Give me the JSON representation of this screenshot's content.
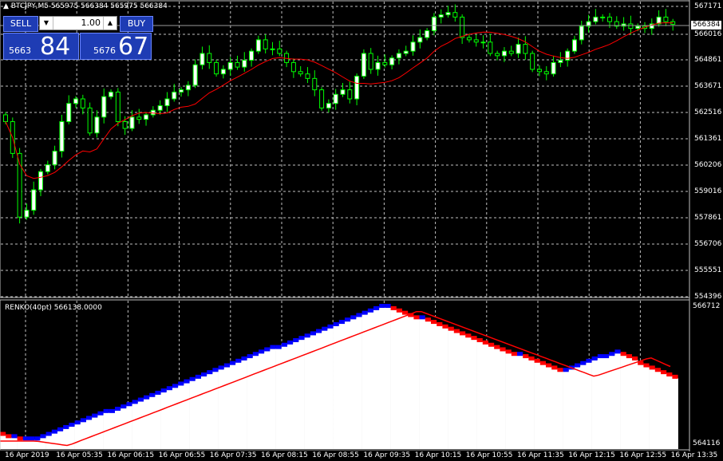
{
  "main_header": "BTCJPY,M5  565975 566384 565975 566384",
  "trade_panel": {
    "sell_label": "SELL",
    "buy_label": "BUY",
    "lot": "1.00",
    "bid_small": "5663",
    "bid_big": "84",
    "ask_small": "5676",
    "ask_big": "67"
  },
  "price_axis": [
    "567171",
    "566016",
    "564861",
    "563671",
    "562516",
    "561361",
    "560206",
    "559016",
    "557861",
    "556706",
    "555551",
    "554396"
  ],
  "current_price": "566384",
  "sub_header": "RENKO(40pt) 566138.0000",
  "sub_axis": {
    "top": "566712",
    "bottom": "564116"
  },
  "time_axis": [
    "16 Apr 2019",
    "16 Apr 05:35",
    "16 Apr 06:15",
    "16 Apr 06:55",
    "16 Apr 07:35",
    "16 Apr 08:15",
    "16 Apr 08:55",
    "16 Apr 09:35",
    "16 Apr 10:15",
    "16 Apr 10:55",
    "16 Apr 11:35",
    "16 Apr 12:15",
    "16 Apr 12:55",
    "16 Apr 13:35"
  ],
  "colors": {
    "background": "#000000",
    "grid": "#c0c0c0",
    "bull_candle": "#ffffff",
    "bear_candle": "#000000",
    "wick": "#00ff00",
    "moving_average": "#ff0000",
    "renko_up": "#0000ff",
    "renko_down": "#ff0000",
    "renko_fill": "#ffffff"
  },
  "chart_data": {
    "type": "candlestick",
    "symbol": "BTCJPY",
    "timeframe": "M5",
    "ylim": [
      554396,
      567171
    ],
    "candles_close_approx": [
      562100,
      560700,
      557900,
      558200,
      559100,
      559900,
      560200,
      560800,
      562100,
      562900,
      563100,
      562700,
      561600,
      562300,
      563200,
      563400,
      562100,
      561800,
      562300,
      562200,
      562400,
      562600,
      562800,
      563100,
      563400,
      563500,
      563700,
      564600,
      565100,
      564700,
      564200,
      564400,
      564700,
      564500,
      564800,
      565200,
      565700,
      565300,
      565300,
      565100,
      564700,
      564300,
      564200,
      564000,
      563500,
      562700,
      562900,
      563300,
      563500,
      563100,
      564100,
      565100,
      564400,
      564700,
      564600,
      564900,
      565100,
      565200,
      565600,
      565800,
      566100,
      566700,
      566800,
      566900,
      566700,
      565800,
      565700,
      565600,
      565600,
      565100,
      565000,
      565200,
      565100,
      565500,
      565100,
      564400,
      564300,
      564200,
      564700,
      564800,
      565200,
      565700,
      566300,
      566500,
      566700,
      566700,
      566500,
      566300,
      566400,
      566200,
      566300,
      566200,
      566400,
      566700,
      566500,
      566384
    ]
  },
  "renko_data": {
    "type": "renko",
    "box_size": "40pt",
    "ylim": [
      564116,
      566712
    ]
  }
}
